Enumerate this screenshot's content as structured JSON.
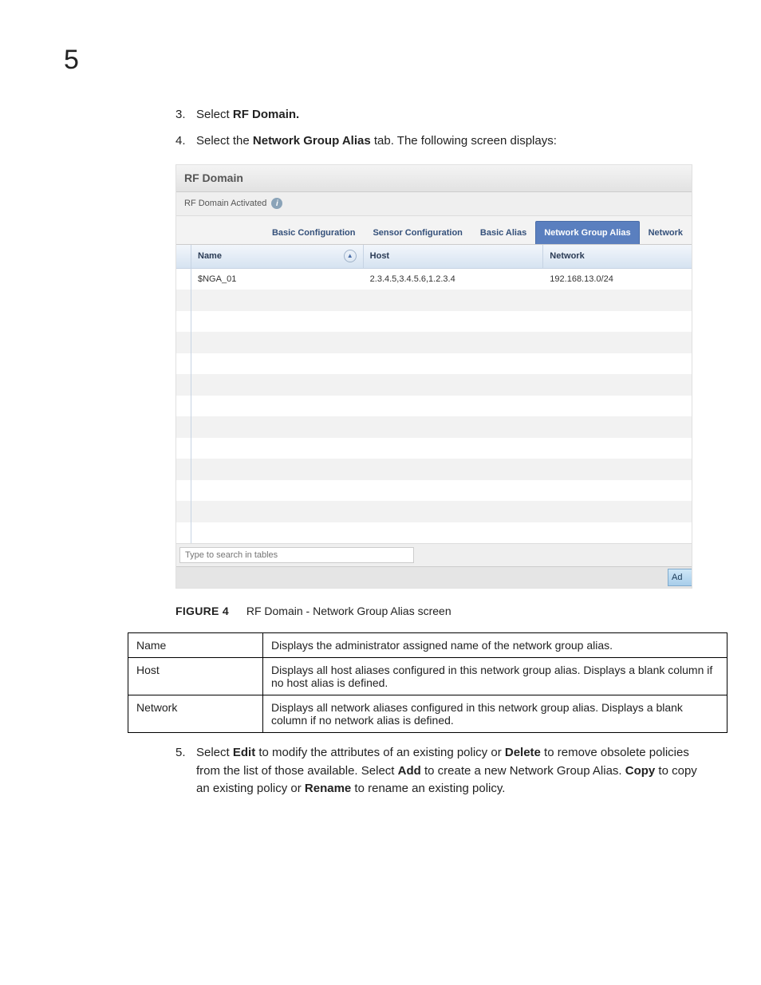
{
  "pageNumber": "5",
  "steps": {
    "s3": {
      "n": "3.",
      "pre": "Select ",
      "bold": "RF Domain."
    },
    "s4": {
      "n": "4.",
      "pre": "Select the ",
      "bold": "Network Group Alias",
      "post": " tab. The following screen displays:"
    },
    "s5": {
      "n": "5.",
      "p1a": "Select ",
      "b1": "Edit",
      "p1b": " to modify the attributes of an existing policy or ",
      "b2": "Delete",
      "p1c": " to remove obsolete policies from the list of those available. Select ",
      "b3": "Add",
      "p1d": " to create a new Network Group Alias. ",
      "b4": "Copy",
      "p1e": " to copy an existing policy or ",
      "b5": "Rename",
      "p1f": " to rename an existing policy."
    }
  },
  "shot": {
    "title": "RF Domain",
    "subtitle": "RF Domain Activated",
    "tabs": [
      "Basic Configuration",
      "Sensor Configuration",
      "Basic Alias",
      "Network Group Alias",
      "Network"
    ],
    "activeTab": 3,
    "cols": {
      "name": "Name",
      "host": "Host",
      "network": "Network"
    },
    "row": {
      "name": "$NGA_01",
      "host": "2.3.4.5,3.4.5.6,1.2.3.4",
      "network": "192.168.13.0/24"
    },
    "searchPlaceholder": "Type to search in tables",
    "footBtn": "Ad"
  },
  "figure": {
    "label": "FIGURE 4",
    "caption": "RF Domain - Network Group Alias screen"
  },
  "desc": [
    {
      "k": "Name",
      "v": "Displays the administrator assigned name of the network group alias."
    },
    {
      "k": "Host",
      "v": "Displays all host aliases configured in this network group alias. Displays a blank column if no host alias is defined."
    },
    {
      "k": "Network",
      "v": "Displays all network aliases configured in this network group alias. Displays a blank column if no network alias is defined."
    }
  ]
}
